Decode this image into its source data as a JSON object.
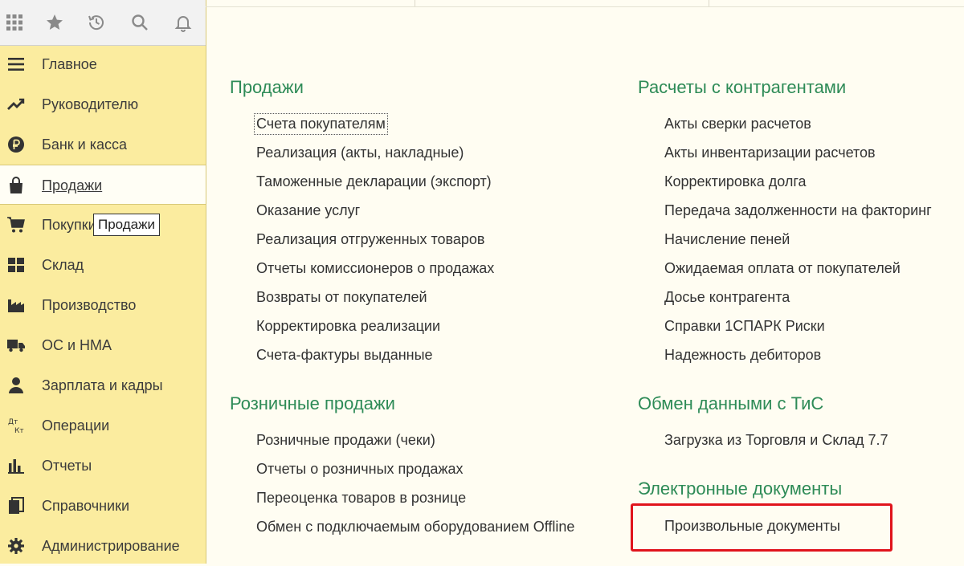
{
  "toolbar": {
    "icons": [
      "apps-grid-icon",
      "favorites-star-icon",
      "history-icon",
      "search-icon",
      "notifications-bell-icon"
    ]
  },
  "sidebar": {
    "items": [
      {
        "label": "Главное",
        "icon": "menu-lines-icon"
      },
      {
        "label": "Руководителю",
        "icon": "trend-chart-icon"
      },
      {
        "label": "Банк и касса",
        "icon": "ruble-coin-icon"
      },
      {
        "label": "Продажи",
        "icon": "shopping-bag-icon",
        "active": true
      },
      {
        "label": "Покупки",
        "icon": "cart-icon"
      },
      {
        "label": "Склад",
        "icon": "warehouse-grid-icon"
      },
      {
        "label": "Производство",
        "icon": "factory-icon"
      },
      {
        "label": "ОС и НМА",
        "icon": "truck-icon"
      },
      {
        "label": "Зарплата и кадры",
        "icon": "person-icon"
      },
      {
        "label": "Операции",
        "icon": "dt-kt-icon"
      },
      {
        "label": "Отчеты",
        "icon": "bar-chart-icon"
      },
      {
        "label": "Справочники",
        "icon": "books-icon"
      },
      {
        "label": "Администрирование",
        "icon": "gear-icon"
      }
    ],
    "tooltip": "Продажи"
  },
  "sections": {
    "sales": {
      "title": "Продажи",
      "links": [
        "Счета покупателям",
        "Реализация (акты, накладные)",
        "Таможенные декларации (экспорт)",
        "Оказание услуг",
        "Реализация отгруженных товаров",
        "Отчеты комиссионеров о продажах",
        "Возвраты от покупателей",
        "Корректировка реализации",
        "Счета-фактуры выданные"
      ]
    },
    "retail": {
      "title": "Розничные продажи",
      "links": [
        "Розничные продажи (чеки)",
        "Отчеты о розничных продажах",
        "Переоценка товаров в рознице",
        "Обмен с подключаемым оборудованием Offline"
      ]
    },
    "settlements": {
      "title": "Расчеты с контрагентами",
      "links": [
        "Акты сверки расчетов",
        "Акты инвентаризации расчетов",
        "Корректировка долга",
        "Передача задолженности на факторинг",
        "Начисление пеней",
        "Ожидаемая оплата от покупателей",
        "Досье контрагента",
        "Справки 1СПАРК Риски",
        "Надежность дебиторов"
      ]
    },
    "exchange": {
      "title": "Обмен данными с ТиС",
      "links": [
        "Загрузка из Торговля и Склад 7.7"
      ]
    },
    "edocs": {
      "title": "Электронные документы",
      "links": [
        "Произвольные документы"
      ]
    }
  },
  "colors": {
    "sidebar_bg": "#fbec9f",
    "content_bg": "#fffdf2",
    "section_title": "#2e8b57",
    "highlight_border": "#e0141c"
  }
}
